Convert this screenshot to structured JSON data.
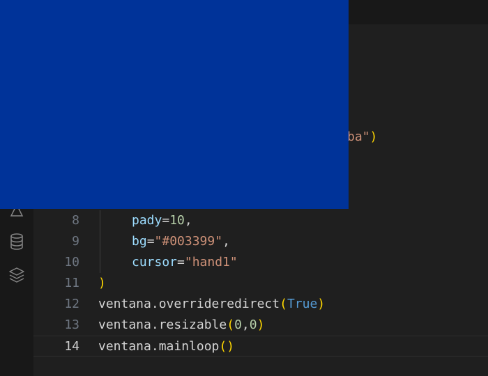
{
  "colors": {
    "overlay": "#003399",
    "editor_bg": "#1f1f1f",
    "activity_bg": "#181818"
  },
  "partial_line": {
    "visible_fragment": "ba\")"
  },
  "activity_bar": {
    "icons": [
      "testing-flask-icon",
      "database-icon",
      "layers-icon"
    ]
  },
  "lines": [
    {
      "number": "8",
      "tokens": [
        {
          "t": "pady",
          "c": "attr"
        },
        {
          "t": "=",
          "c": "plain"
        },
        {
          "t": "10",
          "c": "num"
        },
        {
          "t": ",",
          "c": "plain"
        }
      ]
    },
    {
      "number": "9",
      "tokens": [
        {
          "t": "bg",
          "c": "attr"
        },
        {
          "t": "=",
          "c": "plain"
        },
        {
          "t": "\"#003399\"",
          "c": "str"
        },
        {
          "t": ",",
          "c": "plain"
        }
      ]
    },
    {
      "number": "10",
      "tokens": [
        {
          "t": "cursor",
          "c": "attr"
        },
        {
          "t": "=",
          "c": "plain"
        },
        {
          "t": "\"hand1\"",
          "c": "str"
        }
      ]
    },
    {
      "number": "11",
      "tokens": [
        {
          "t": ")",
          "c": "paren"
        }
      ]
    },
    {
      "number": "12",
      "tokens": [
        {
          "t": "ventana.overrideredirect",
          "c": "plain"
        },
        {
          "t": "(",
          "c": "paren"
        },
        {
          "t": "True",
          "c": "kw"
        },
        {
          "t": ")",
          "c": "paren"
        }
      ]
    },
    {
      "number": "13",
      "tokens": [
        {
          "t": "ventana.resizable",
          "c": "plain"
        },
        {
          "t": "(",
          "c": "paren"
        },
        {
          "t": "0",
          "c": "num"
        },
        {
          "t": ",",
          "c": "plain"
        },
        {
          "t": "0",
          "c": "num"
        },
        {
          "t": ")",
          "c": "paren"
        }
      ]
    },
    {
      "number": "14",
      "tokens": [
        {
          "t": "ventana.mainloop",
          "c": "plain"
        },
        {
          "t": "()",
          "c": "paren"
        }
      ]
    }
  ]
}
